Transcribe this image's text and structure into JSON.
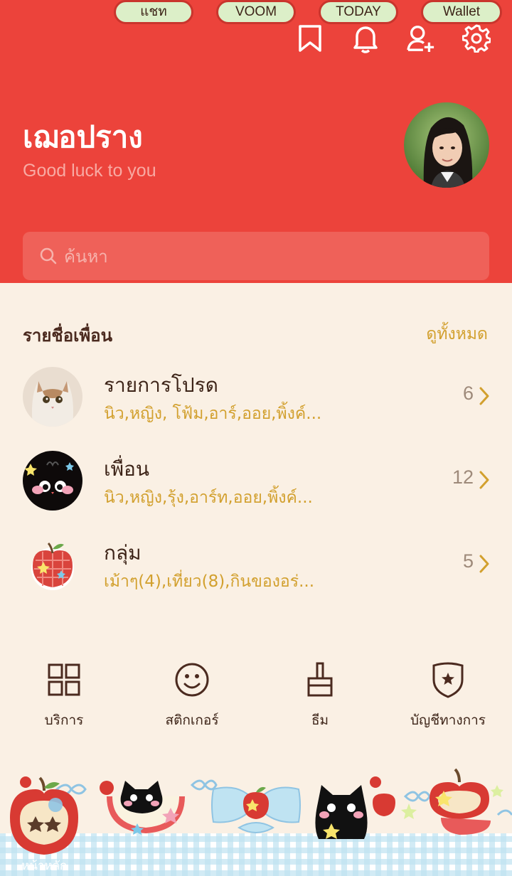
{
  "header": {
    "profile_name": "เฌอปราง",
    "profile_status": "Good luck to you",
    "search_placeholder": "ค้นหา",
    "accent": "#EC433B"
  },
  "friends_section": {
    "title": "รายชื่อเพื่อน",
    "view_all": "ดูทั้งหมด",
    "rows": [
      {
        "title": "รายการโปรด",
        "sub": "นิว,หญิง, โฟ้ม,อาร์,ออย,พิ้งค์...",
        "count": "6"
      },
      {
        "title": "เพื่อน",
        "sub": "นิว,หญิง,รุ้ง,อาร์ท,ออย,พิ้งค์...",
        "count": "12"
      },
      {
        "title": "กลุ่ม",
        "sub": "เม้าๆ(4),เที่ยว(8),กินของอร่...",
        "count": "5"
      }
    ]
  },
  "menu": {
    "items": [
      {
        "label": "บริการ",
        "icon": "grid-icon"
      },
      {
        "label": "สติกเกอร์",
        "icon": "smiley-icon"
      },
      {
        "label": "ธีม",
        "icon": "brush-icon"
      },
      {
        "label": "บัญชีทางการ",
        "icon": "shield-star-icon"
      }
    ]
  },
  "tabs": {
    "home": "หน้าหลัก",
    "chat": "แชท",
    "voom": "VOOM",
    "today": "TODAY",
    "wallet": "Wallet"
  }
}
